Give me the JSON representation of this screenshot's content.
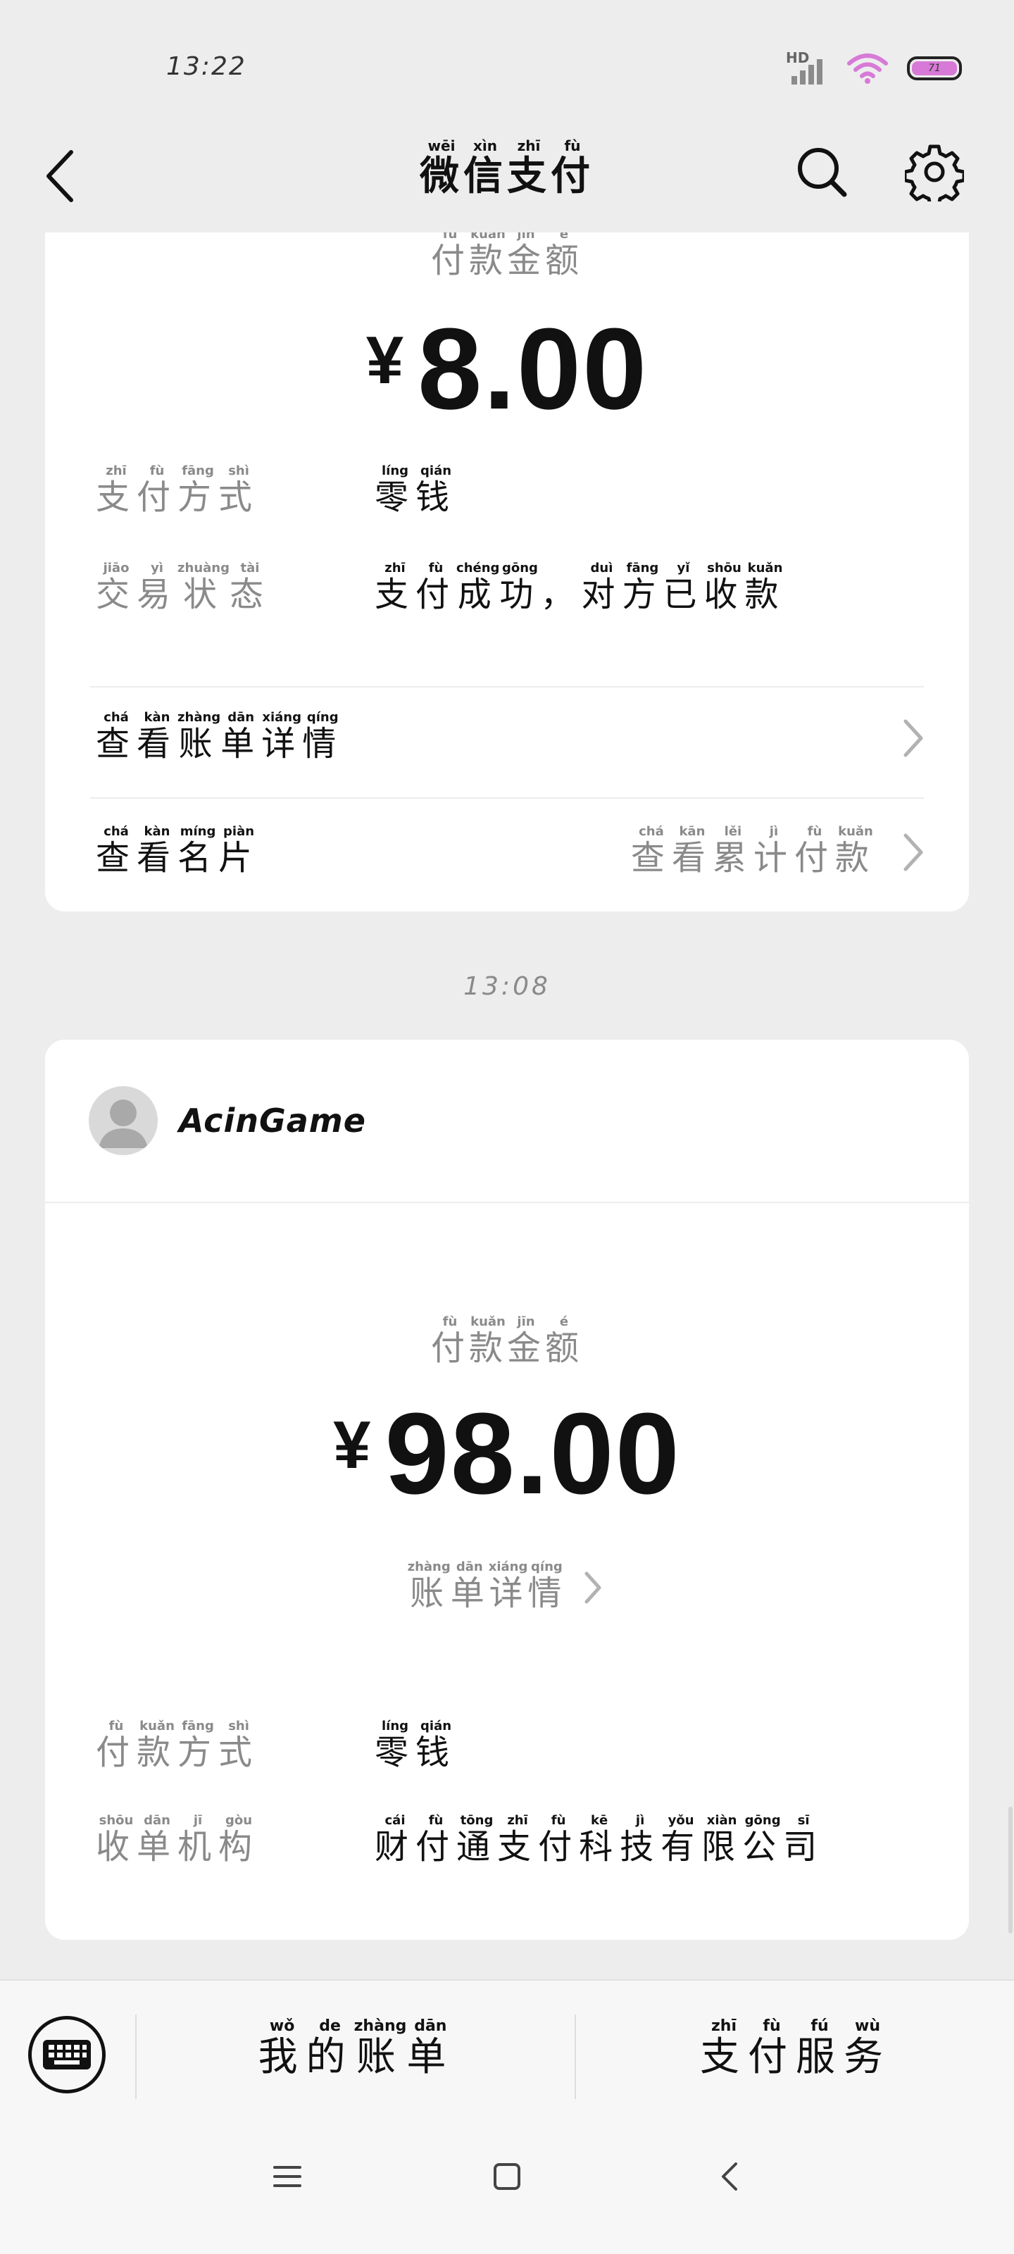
{
  "status_bar": {
    "time": "13:22",
    "network": "HD",
    "battery": "71"
  },
  "nav": {
    "title": [
      {
        "c": "微",
        "p": "wēi"
      },
      {
        "c": "信",
        "p": "xìn"
      },
      {
        "c": "支",
        "p": "zhī"
      },
      {
        "c": "付",
        "p": "fù"
      }
    ]
  },
  "card1": {
    "amount_label": [
      {
        "c": "付",
        "p": "fù"
      },
      {
        "c": "款",
        "p": "kuǎn"
      },
      {
        "c": "金",
        "p": "jīn"
      },
      {
        "c": "额",
        "p": "é"
      }
    ],
    "currency": "¥",
    "amount": "8.00",
    "rows": [
      {
        "key": [
          {
            "c": "支",
            "p": "zhī"
          },
          {
            "c": "付",
            "p": "fù"
          },
          {
            "c": "方",
            "p": "fāng"
          },
          {
            "c": "式",
            "p": "shì"
          }
        ],
        "value": [
          {
            "c": "零",
            "p": "líng"
          },
          {
            "c": "钱",
            "p": "qián"
          }
        ]
      },
      {
        "key": [
          {
            "c": "交",
            "p": "jiāo"
          },
          {
            "c": "易",
            "p": "yì"
          },
          {
            "c": "状",
            "p": "zhuàng"
          },
          {
            "c": "态",
            "p": "tài"
          }
        ],
        "value": [
          {
            "c": "支",
            "p": "zhī"
          },
          {
            "c": "付",
            "p": "fù"
          },
          {
            "c": "成",
            "p": "chéng"
          },
          {
            "c": "功",
            "p": "gōng"
          },
          {
            "c": "，",
            "p": ""
          },
          {
            "c": "对",
            "p": "duì"
          },
          {
            "c": "方",
            "p": "fāng"
          },
          {
            "c": "已",
            "p": "yǐ"
          },
          {
            "c": "收",
            "p": "shōu"
          },
          {
            "c": "款",
            "p": "kuǎn"
          }
        ]
      }
    ],
    "view_bill": [
      {
        "c": "查",
        "p": "chá"
      },
      {
        "c": "看",
        "p": "kàn"
      },
      {
        "c": "账",
        "p": "zhàng"
      },
      {
        "c": "单",
        "p": "dān"
      },
      {
        "c": "详",
        "p": "xiáng"
      },
      {
        "c": "情",
        "p": "qíng"
      }
    ],
    "view_card": [
      {
        "c": "查",
        "p": "chá"
      },
      {
        "c": "看",
        "p": "kàn"
      },
      {
        "c": "名",
        "p": "míng"
      },
      {
        "c": "片",
        "p": "piàn"
      }
    ],
    "view_total": [
      {
        "c": "查",
        "p": "chá"
      },
      {
        "c": "看",
        "p": "kān"
      },
      {
        "c": "累",
        "p": "lěi"
      },
      {
        "c": "计",
        "p": "jì"
      },
      {
        "c": "付",
        "p": "fù"
      },
      {
        "c": "款",
        "p": "kuǎn"
      }
    ]
  },
  "time_separator": "13:08",
  "card2": {
    "merchant": "AcinGame",
    "amount_label": [
      {
        "c": "付",
        "p": "fù"
      },
      {
        "c": "款",
        "p": "kuǎn"
      },
      {
        "c": "金",
        "p": "jīn"
      },
      {
        "c": "额",
        "p": "é"
      }
    ],
    "currency": "¥",
    "amount": "98.00",
    "bill_detail": [
      {
        "c": "账",
        "p": "zhàng"
      },
      {
        "c": "单",
        "p": "dān"
      },
      {
        "c": "详",
        "p": "xiáng"
      },
      {
        "c": "情",
        "p": "qíng"
      }
    ],
    "rows": [
      {
        "key": [
          {
            "c": "付",
            "p": "fù"
          },
          {
            "c": "款",
            "p": "kuǎn"
          },
          {
            "c": "方",
            "p": "fāng"
          },
          {
            "c": "式",
            "p": "shì"
          }
        ],
        "value": [
          {
            "c": "零",
            "p": "líng"
          },
          {
            "c": "钱",
            "p": "qián"
          }
        ]
      },
      {
        "key": [
          {
            "c": "收",
            "p": "shōu"
          },
          {
            "c": "单",
            "p": "dān"
          },
          {
            "c": "机",
            "p": "jī"
          },
          {
            "c": "构",
            "p": "gòu"
          }
        ],
        "value": [
          {
            "c": "财",
            "p": "cái"
          },
          {
            "c": "付",
            "p": "fù"
          },
          {
            "c": "通",
            "p": "tōng"
          },
          {
            "c": "支",
            "p": "zhī"
          },
          {
            "c": "付",
            "p": "fù"
          },
          {
            "c": "科",
            "p": "kē"
          },
          {
            "c": "技",
            "p": "jì"
          },
          {
            "c": "有",
            "p": "yǒu"
          },
          {
            "c": "限",
            "p": "xiàn"
          },
          {
            "c": "公",
            "p": "gōng"
          },
          {
            "c": "司",
            "p": "sī"
          }
        ]
      }
    ]
  },
  "bottom_bar": {
    "my_bills": [
      {
        "c": "我",
        "p": "wǒ"
      },
      {
        "c": "的",
        "p": "de"
      },
      {
        "c": "账",
        "p": "zhàng"
      },
      {
        "c": "单",
        "p": "dān"
      }
    ],
    "pay_services": [
      {
        "c": "支",
        "p": "zhī"
      },
      {
        "c": "付",
        "p": "fù"
      },
      {
        "c": "服",
        "p": "fú"
      },
      {
        "c": "务",
        "p": "wù"
      }
    ]
  }
}
